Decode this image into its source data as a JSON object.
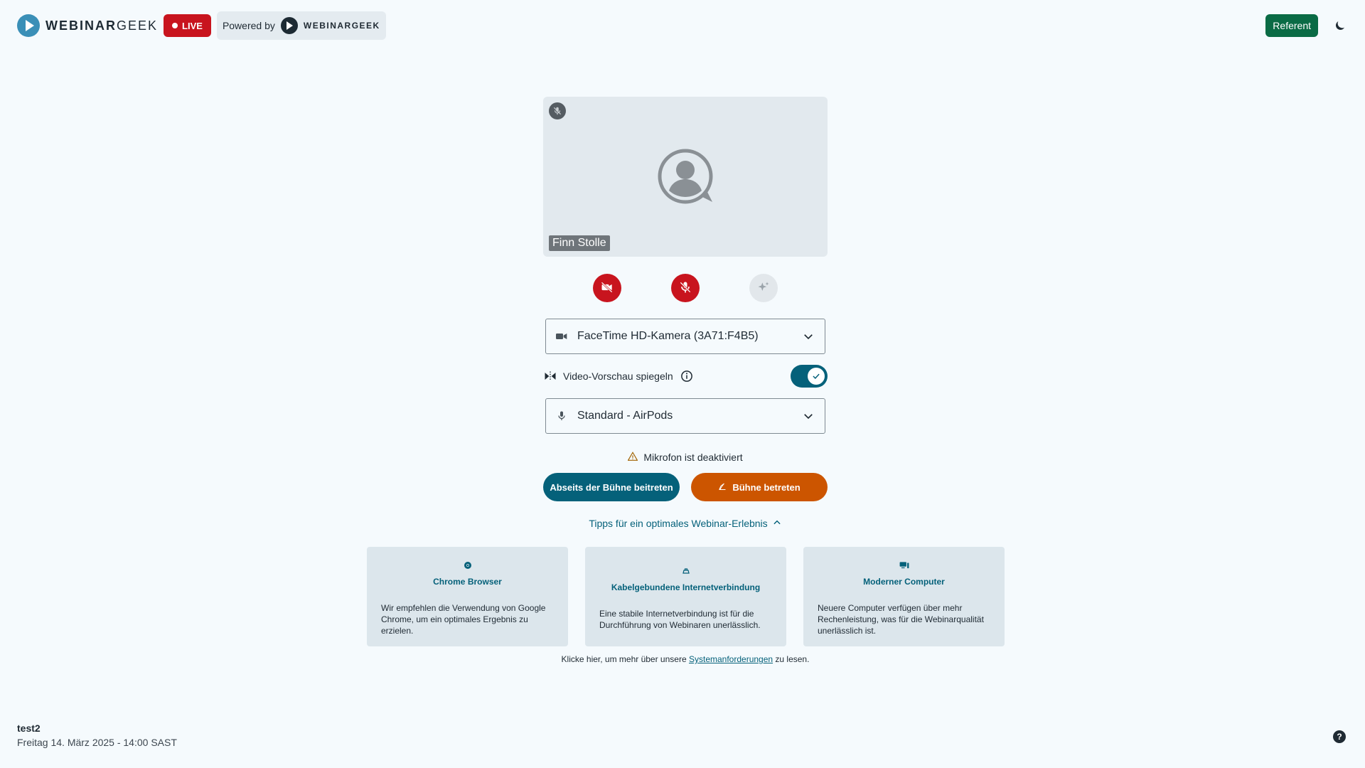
{
  "header": {
    "brand_bold": "WEBINAR",
    "brand_light": "GEEK",
    "live_label": "LIVE",
    "powered_by": "Powered by",
    "powered_brand": "WEBINARGEEK",
    "role_button": "Referent",
    "theme_icon": "moon-icon"
  },
  "preview": {
    "participant_name": "Finn Stolle",
    "mute_icon": "mic-off-icon",
    "avatar_icon": "user-avatar-icon"
  },
  "controls": {
    "camera_icon": "camera-off-icon",
    "mic_icon": "mic-off-icon",
    "effects_icon": "sparkles-icon"
  },
  "camera_select": {
    "value": "FaceTime HD-Kamera (3A71:F4B5)",
    "icon": "video-camera-icon"
  },
  "mirror": {
    "label": "Video-Vorschau spiegeln",
    "enabled": true
  },
  "mic_select": {
    "value": "Standard - AirPods",
    "icon": "microphone-icon"
  },
  "warning": {
    "text": "Mikrofon ist deaktiviert",
    "icon": "warning-triangle-icon"
  },
  "buttons": {
    "offstage": "Abseits der Bühne beitreten",
    "onstage": "Bühne betreten"
  },
  "tips": {
    "toggle_label": "Tipps für ein optimales Webinar-Erlebnis",
    "cards": [
      {
        "icon": "chrome-icon",
        "title": "Chrome Browser",
        "text": "Wir empfehlen die Verwendung von Google Chrome, um ein optimales Ergebnis zu erzielen."
      },
      {
        "icon": "network-icon",
        "title": "Kabelgebundene Internetverbindung",
        "text": "Eine stabile Internetverbindung ist für die Durchführung von Webinaren unerlässlich."
      },
      {
        "icon": "computer-icon",
        "title": "Moderner Computer",
        "text": "Neuere Computer verfügen über mehr Rechenleistung, was für die Webinarqualität unerlässlich ist."
      }
    ]
  },
  "sysreq": {
    "prefix": "Klicke hier, um mehr über unsere",
    "link": "Systemanforderungen",
    "suffix": "zu lesen."
  },
  "footer": {
    "event_title": "test2",
    "event_date": "Freitag 14. März 2025 - 14:00 SAST",
    "help_label": "?"
  },
  "colors": {
    "live_red": "#c8141e",
    "teal": "#05617a",
    "orange": "#cc5500",
    "role_green": "#0a6b45"
  }
}
